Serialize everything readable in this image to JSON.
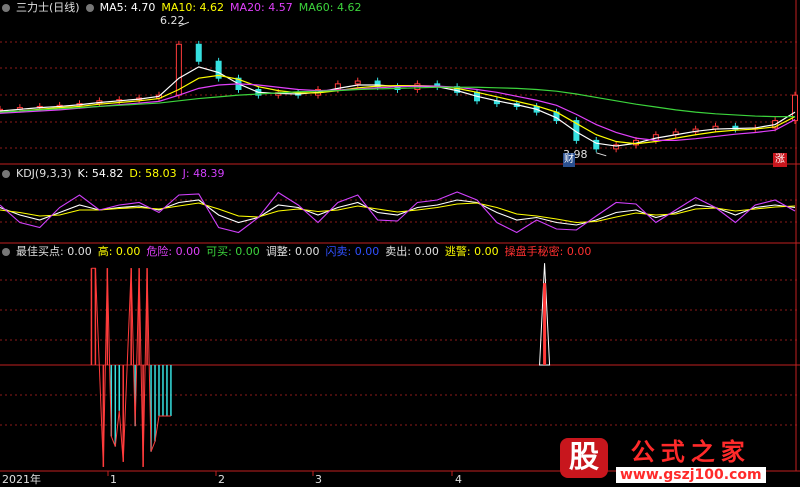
{
  "colors": {
    "bg": "#000000",
    "grid": "#8b1a1a",
    "up": "#ff3b3b",
    "down": "#36e0e0",
    "ma5": "#ffffff",
    "ma10": "#ffff00",
    "ma20": "#e040fb",
    "ma60": "#3cd43c",
    "k": "#ffffff",
    "d": "#ffff00",
    "j": "#d040fb"
  },
  "header": {
    "title": "三力士(日线)",
    "ma5_label": "MA5:",
    "ma5_value": "4.70",
    "ma10_label": "MA10:",
    "ma10_value": "4.62",
    "ma20_label": "MA20:",
    "ma20_value": "4.57",
    "ma60_label": "MA60:",
    "ma60_value": "4.62"
  },
  "price_panel": {
    "high_label": "6.22",
    "low_label": "3.98",
    "low_badge": "财",
    "right_badge": "涨"
  },
  "kdj_panel": {
    "title": "KDJ(9,3,3)",
    "k_label": "K:",
    "k_value": "54.82",
    "d_label": "D:",
    "d_value": "58.03",
    "j_label": "J:",
    "j_value": "48.39"
  },
  "indicator_panel": {
    "items": [
      {
        "label": "最佳买点:",
        "value": "0.00",
        "color": "#e0e0e0"
      },
      {
        "label": "高:",
        "value": "0.00",
        "color": "#ffff00"
      },
      {
        "label": "危险:",
        "value": "0.00",
        "color": "#e040fb"
      },
      {
        "label": "可买:",
        "value": "0.00",
        "color": "#3cd43c"
      },
      {
        "label": "调整:",
        "value": "0.00",
        "color": "#e0e0e0"
      },
      {
        "label": "闪卖:",
        "value": "0.00",
        "color": "#3050ff"
      },
      {
        "label": "卖出:",
        "value": "0.00",
        "color": "#e0e0e0"
      },
      {
        "label": "逃警:",
        "value": "0.00",
        "color": "#ffff00"
      },
      {
        "label": "操盘手秘密:",
        "value": "0.00",
        "color": "#ff3030"
      }
    ]
  },
  "x_axis": {
    "year": "2021年",
    "months": [
      "1",
      "2",
      "3",
      "4"
    ]
  },
  "watermark": {
    "logo": "股",
    "title": "公式之家",
    "url": "www.gszj100.com"
  },
  "chart_data": [
    {
      "type": "line",
      "name": "price",
      "ylim": [
        3.8,
        6.4
      ],
      "x": [
        0,
        5,
        10,
        15,
        20,
        25,
        30,
        35,
        40,
        45,
        50,
        55,
        60,
        65,
        70,
        75,
        80,
        85,
        90,
        95,
        100,
        105,
        110,
        115,
        120,
        125,
        130,
        135,
        140,
        145,
        150,
        155,
        160,
        165,
        170,
        175,
        180,
        185,
        190,
        195,
        200
      ],
      "close": [
        4.75,
        4.78,
        4.8,
        4.82,
        4.85,
        4.9,
        4.92,
        4.95,
        5.0,
        5.9,
        5.6,
        5.3,
        5.1,
        5.0,
        5.05,
        5.0,
        5.1,
        5.2,
        5.25,
        5.15,
        5.1,
        5.2,
        5.15,
        5.05,
        4.9,
        4.85,
        4.8,
        4.7,
        4.55,
        4.2,
        4.05,
        4.12,
        4.2,
        4.3,
        4.35,
        4.4,
        4.45,
        4.4,
        4.42,
        4.55,
        5.0
      ],
      "high_marker": 6.22,
      "low_marker": 3.98,
      "series": [
        {
          "name": "MA5",
          "values": [
            4.72,
            4.75,
            4.78,
            4.8,
            4.83,
            4.87,
            4.9,
            4.93,
            4.98,
            5.3,
            5.5,
            5.4,
            5.2,
            5.05,
            5.03,
            5.02,
            5.05,
            5.12,
            5.18,
            5.18,
            5.15,
            5.16,
            5.15,
            5.08,
            4.98,
            4.9,
            4.83,
            4.75,
            4.6,
            4.35,
            4.15,
            4.1,
            4.15,
            4.24,
            4.3,
            4.36,
            4.4,
            4.41,
            4.42,
            4.48,
            4.7
          ]
        },
        {
          "name": "MA10",
          "values": [
            4.7,
            4.72,
            4.75,
            4.78,
            4.8,
            4.84,
            4.87,
            4.9,
            4.94,
            5.1,
            5.3,
            5.35,
            5.28,
            5.15,
            5.08,
            5.04,
            5.04,
            5.08,
            5.13,
            5.16,
            5.17,
            5.17,
            5.16,
            5.12,
            5.05,
            4.97,
            4.89,
            4.81,
            4.7,
            4.5,
            4.3,
            4.18,
            4.14,
            4.18,
            4.24,
            4.3,
            4.35,
            4.38,
            4.4,
            4.44,
            4.62
          ]
        },
        {
          "name": "MA20",
          "values": [
            4.68,
            4.7,
            4.72,
            4.74,
            4.77,
            4.8,
            4.83,
            4.86,
            4.89,
            5.0,
            5.12,
            5.18,
            5.2,
            5.18,
            5.14,
            5.1,
            5.08,
            5.09,
            5.11,
            5.13,
            5.15,
            5.16,
            5.16,
            5.14,
            5.1,
            5.05,
            4.98,
            4.91,
            4.82,
            4.66,
            4.48,
            4.34,
            4.24,
            4.2,
            4.2,
            4.23,
            4.27,
            4.31,
            4.34,
            4.38,
            4.57
          ]
        },
        {
          "name": "MA60",
          "values": [
            4.7,
            4.72,
            4.74,
            4.76,
            4.78,
            4.8,
            4.82,
            4.84,
            4.86,
            4.9,
            4.94,
            4.97,
            5.0,
            5.02,
            5.04,
            5.06,
            5.07,
            5.08,
            5.1,
            5.11,
            5.12,
            5.13,
            5.14,
            5.14,
            5.14,
            5.13,
            5.12,
            5.1,
            5.07,
            5.02,
            4.96,
            4.9,
            4.84,
            4.79,
            4.74,
            4.7,
            4.67,
            4.65,
            4.63,
            4.62,
            4.62
          ]
        }
      ]
    },
    {
      "type": "line",
      "name": "KDJ",
      "ylim": [
        -10,
        110
      ],
      "x": [
        0,
        5,
        10,
        15,
        20,
        25,
        30,
        35,
        40,
        45,
        50,
        55,
        60,
        65,
        70,
        75,
        80,
        85,
        90,
        95,
        100,
        105,
        110,
        115,
        120,
        125,
        130,
        135,
        140,
        145,
        150,
        155,
        160,
        165,
        170,
        175,
        180,
        185,
        190,
        195,
        200
      ],
      "series": [
        {
          "name": "K",
          "values": [
            55,
            40,
            30,
            45,
            60,
            50,
            55,
            58,
            50,
            65,
            70,
            40,
            25,
            35,
            60,
            55,
            40,
            55,
            65,
            45,
            40,
            55,
            60,
            70,
            65,
            45,
            30,
            35,
            25,
            20,
            30,
            45,
            50,
            35,
            45,
            60,
            55,
            40,
            55,
            60,
            55
          ]
        },
        {
          "name": "D",
          "values": [
            50,
            45,
            38,
            40,
            50,
            50,
            53,
            55,
            52,
            58,
            64,
            52,
            38,
            36,
            48,
            52,
            47,
            50,
            58,
            52,
            46,
            50,
            55,
            62,
            64,
            55,
            42,
            38,
            32,
            25,
            27,
            36,
            44,
            40,
            42,
            52,
            54,
            48,
            52,
            56,
            58
          ]
        },
        {
          "name": "J",
          "values": [
            60,
            25,
            15,
            55,
            80,
            50,
            60,
            65,
            45,
            80,
            82,
            15,
            5,
            35,
            85,
            60,
            25,
            65,
            80,
            30,
            28,
            65,
            70,
            86,
            70,
            25,
            5,
            30,
            12,
            10,
            38,
            65,
            62,
            25,
            50,
            75,
            55,
            25,
            60,
            70,
            48
          ]
        }
      ]
    },
    {
      "type": "bar",
      "name": "indicator",
      "ylim": [
        -105,
        105
      ],
      "bars": [
        {
          "x": 23,
          "value": 95,
          "color": "up"
        },
        {
          "x": 24,
          "value": 95,
          "color": "up"
        },
        {
          "x": 26,
          "value": -100,
          "color": "up"
        },
        {
          "x": 27,
          "value": 95,
          "color": "up"
        },
        {
          "x": 28,
          "value": -70,
          "color": "down"
        },
        {
          "x": 29,
          "value": -80,
          "color": "down"
        },
        {
          "x": 30,
          "value": -45,
          "color": "down"
        },
        {
          "x": 31,
          "value": -95,
          "color": "up"
        },
        {
          "x": 33,
          "value": 95,
          "color": "up"
        },
        {
          "x": 34,
          "value": -60,
          "color": "down"
        },
        {
          "x": 35,
          "value": 95,
          "color": "up"
        },
        {
          "x": 36,
          "value": -100,
          "color": "up"
        },
        {
          "x": 37,
          "value": 95,
          "color": "up"
        },
        {
          "x": 38,
          "value": -85,
          "color": "down"
        },
        {
          "x": 39,
          "value": -75,
          "color": "down"
        },
        {
          "x": 40,
          "value": -50,
          "color": "down"
        },
        {
          "x": 41,
          "value": -50,
          "color": "down"
        },
        {
          "x": 42,
          "value": -50,
          "color": "down"
        },
        {
          "x": 43,
          "value": -50,
          "color": "down"
        },
        {
          "x": 137,
          "value": 100,
          "color": "spike"
        }
      ]
    }
  ]
}
